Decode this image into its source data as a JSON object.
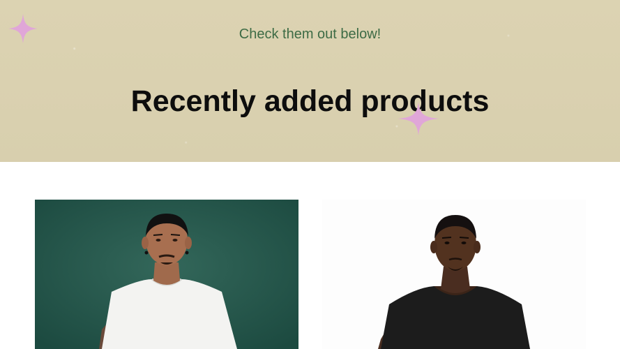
{
  "hero": {
    "subtitle": "Check them out below!",
    "title": "Recently added products",
    "background_color": "#ddd4b3",
    "sparkle_color": "#e0a6d8"
  },
  "products": [
    {
      "image": "man-white-tshirt-green-backdrop-photo"
    },
    {
      "image": "man-black-tshirt-white-backdrop-photo"
    }
  ]
}
